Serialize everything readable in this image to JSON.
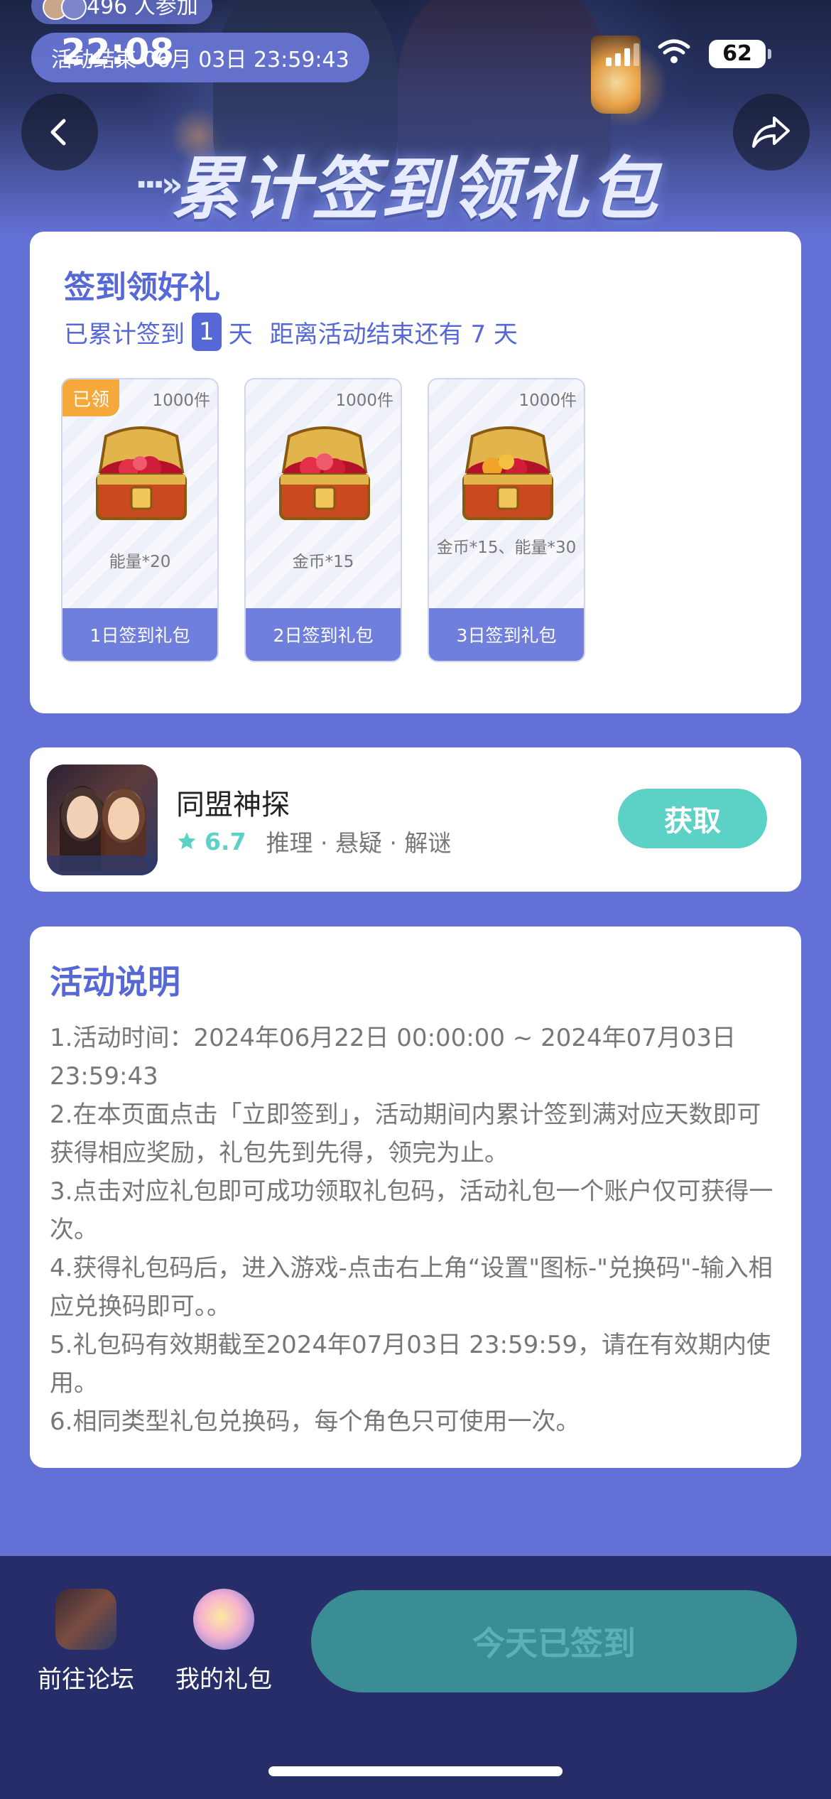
{
  "status_bar": {
    "time": "22:08",
    "battery": "62",
    "icons": [
      "signal-icon",
      "wifi-icon",
      "battery-icon"
    ]
  },
  "header": {
    "participants_text": "496 人参加",
    "countdown_text": "活动结束 06月 03日 23:59:43",
    "banner_title": "累计签到领礼包",
    "back_icon": "back-arrow-icon",
    "share_icon": "share-icon"
  },
  "signin": {
    "title": "签到领好礼",
    "summary_prefix": "已累计签到",
    "days_count": "1",
    "days_unit": "天",
    "remaining_text": "距离活动结束还有 7 天",
    "claimed_tag": "已领",
    "gifts": [
      {
        "quantity": "1000件",
        "reward": "能量*20",
        "label": "1日签到礼包",
        "claimed": true
      },
      {
        "quantity": "1000件",
        "reward": "金币*15",
        "label": "2日签到礼包",
        "claimed": false
      },
      {
        "quantity": "1000件",
        "reward": "金币*15、能量*30",
        "label": "3日签到礼包",
        "claimed": false
      }
    ]
  },
  "app": {
    "name": "同盟神探",
    "rating": "6.7",
    "tags": "推理 · 悬疑 · 解谜",
    "get_label": "获取",
    "rating_icon": "star-icon",
    "accent": "#5cd1c5"
  },
  "rules": {
    "title": "活动说明",
    "items": [
      "1.活动时间：2024年06月22日 00:00:00 ~ 2024年07月03日 23:59:43",
      "2.在本页面点击「立即签到」，活动期间内累计签到满对应天数即可获得相应奖励，礼包先到先得，领完为止。",
      "3.点击对应礼包即可成功领取礼包码，活动礼包一个账户仅可获得一次。",
      "4.获得礼包码后，进入游戏-点击右上角“设置\"图标-\"兑换码\"-输入相应兑换码即可。。",
      "5.礼包码有效期截至2024年07月03日 23:59:59，请在有效期内使用。",
      "6.相同类型礼包兑换码，每个角色只可使用一次。"
    ]
  },
  "bottom_bar": {
    "forum_label": "前往论坛",
    "gifts_label": "我的礼包",
    "checkin_label": "今天已签到"
  },
  "colors": {
    "background": "#6371d6",
    "primary_text": "#5668d6",
    "bottom_bar": "#262d68",
    "claimed_tag": "#f6a93b",
    "checked_button": "#3a8d95"
  }
}
